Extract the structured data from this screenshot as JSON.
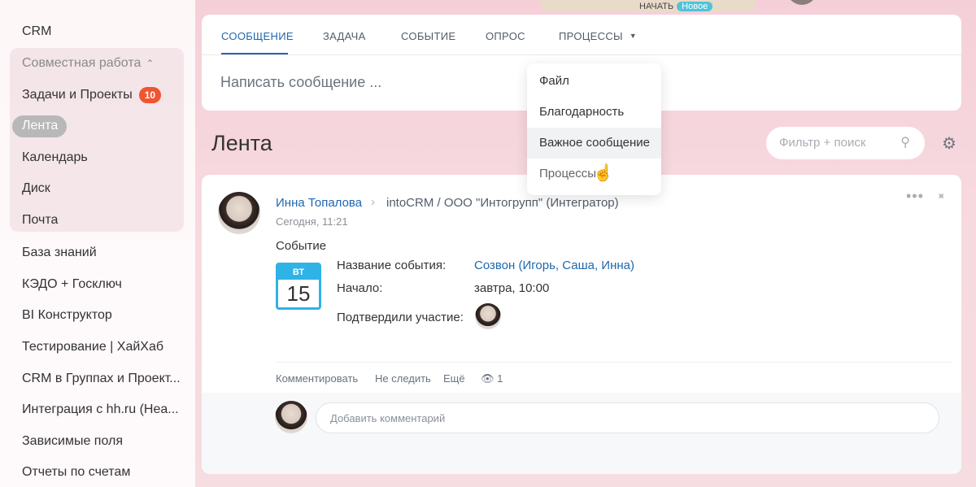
{
  "sidebar": {
    "items": [
      {
        "label": "CRM"
      },
      {
        "label": "Совместная работа"
      },
      {
        "label": "Задачи и Проекты",
        "badge": "10"
      },
      {
        "label": "Лента"
      },
      {
        "label": "Календарь"
      },
      {
        "label": "Диск"
      },
      {
        "label": "Почта"
      },
      {
        "label": "База знаний"
      },
      {
        "label": "КЭДО + Госключ"
      },
      {
        "label": "BI Конструктор"
      },
      {
        "label": "Тестирование | ХайХаб"
      },
      {
        "label": "CRM в Группах и Проект..."
      },
      {
        "label": "Интеграция с hh.ru (Hea..."
      },
      {
        "label": "Зависимые поля"
      },
      {
        "label": "Отчеты по счетам"
      }
    ]
  },
  "top": {
    "promo_text": "НАЧАТЬ",
    "promo_badge": "Новое"
  },
  "composer": {
    "tabs": [
      "СООБЩЕНИЕ",
      "ЗАДАЧА",
      "СОБЫТИЕ",
      "ОПРОС",
      "ПРОЦЕССЫ"
    ],
    "placeholder": "Написать сообщение ..."
  },
  "dropdown": {
    "items": [
      "Файл",
      "Благодарность",
      "Важное сообщение",
      "Процессы"
    ]
  },
  "feed": {
    "title": "Лента",
    "filter_placeholder": "Фильтр + поиск"
  },
  "post": {
    "author": "Инна Топалова",
    "destination": "intoCRM / ООО \"Интогрупп\" (Интегратор)",
    "time": "Сегодня, 11:21",
    "type": "Событие",
    "calendar": {
      "weekday": "ВТ",
      "day": "15"
    },
    "event_name_label": "Название события:",
    "event_name": "Созвон (Игорь, Саша, Инна)",
    "start_label": "Начало:",
    "start": "завтра, 10:00",
    "confirmed_label": "Подтвердили участие:",
    "actions": {
      "comment": "Комментировать",
      "unfollow": "Не следить",
      "more": "Ещё",
      "views": "1"
    },
    "comment_placeholder": "Добавить комментарий"
  },
  "icons": [
    "chevron-up-icon",
    "search-icon",
    "gear-icon",
    "more-dots-icon",
    "pin-icon",
    "eye-icon",
    "caret-down-icon",
    "hand-cursor-icon"
  ],
  "colors": {
    "accent": "#2067b0",
    "badge": "#f0552f",
    "calendar": "#2fb2e6"
  }
}
